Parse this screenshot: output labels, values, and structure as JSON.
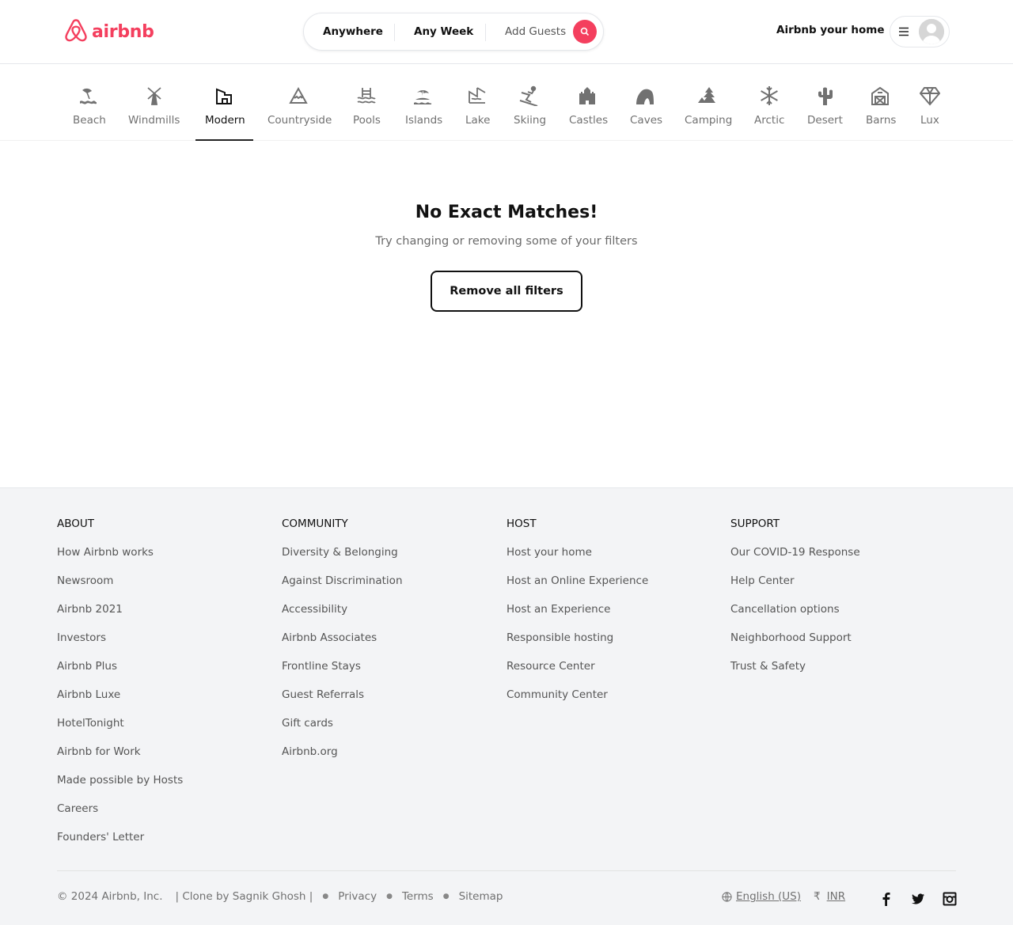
{
  "brand": {
    "name": "airbnb",
    "color": "#f43f5e"
  },
  "search": {
    "anywhere": "Anywhere",
    "week": "Any Week",
    "guests": "Add Guests"
  },
  "header": {
    "host_link": "Airbnb your home"
  },
  "categories": [
    {
      "label": "Beach",
      "icon": "beach-icon"
    },
    {
      "label": "Windmills",
      "icon": "windmill-icon"
    },
    {
      "label": "Modern",
      "icon": "modern-icon",
      "active": true
    },
    {
      "label": "Countryside",
      "icon": "mountain-icon"
    },
    {
      "label": "Pools",
      "icon": "pool-icon"
    },
    {
      "label": "Islands",
      "icon": "island-icon"
    },
    {
      "label": "Lake",
      "icon": "lake-icon"
    },
    {
      "label": "Skiing",
      "icon": "skiing-icon"
    },
    {
      "label": "Castles",
      "icon": "castle-icon"
    },
    {
      "label": "Caves",
      "icon": "cave-icon"
    },
    {
      "label": "Camping",
      "icon": "camping-icon"
    },
    {
      "label": "Arctic",
      "icon": "snowflake-icon"
    },
    {
      "label": "Desert",
      "icon": "cactus-icon"
    },
    {
      "label": "Barns",
      "icon": "barn-icon"
    },
    {
      "label": "Lux",
      "icon": "diamond-icon"
    }
  ],
  "main": {
    "title": "No Exact Matches!",
    "subtitle": "Try changing or removing some of your filters",
    "button": "Remove all filters"
  },
  "footer": {
    "about": {
      "title": "ABOUT",
      "links": [
        "How Airbnb works",
        "Newsroom",
        "Airbnb 2021",
        "Investors",
        "Airbnb Plus",
        "Airbnb Luxe",
        "HotelTonight",
        "Airbnb for Work",
        "Made possible by Hosts",
        "Careers",
        "Founders' Letter"
      ]
    },
    "community": {
      "title": "COMMUNITY",
      "links": [
        "Diversity & Belonging",
        "Against Discrimination",
        "Accessibility",
        "Airbnb Associates",
        "Frontline Stays",
        "Guest Referrals",
        "Gift cards",
        "Airbnb.org"
      ]
    },
    "host": {
      "title": "HOST",
      "links": [
        "Host your home",
        "Host an Online Experience",
        "Host an Experience",
        "Responsible hosting",
        "Resource Center",
        "Community Center"
      ]
    },
    "support": {
      "title": "SUPPORT",
      "links": [
        "Our COVID-19 Response",
        "Help Center",
        "Cancellation options",
        "Neighborhood Support",
        "Trust & Safety"
      ]
    },
    "copyright": "© 2024 Airbnb, Inc.",
    "clone": "| Clone by Sagnik Ghosh |",
    "privacy": "Privacy",
    "terms": "Terms",
    "sitemap": "Sitemap",
    "language": "English (US)",
    "currency_symbol": "₹",
    "currency": "INR"
  }
}
